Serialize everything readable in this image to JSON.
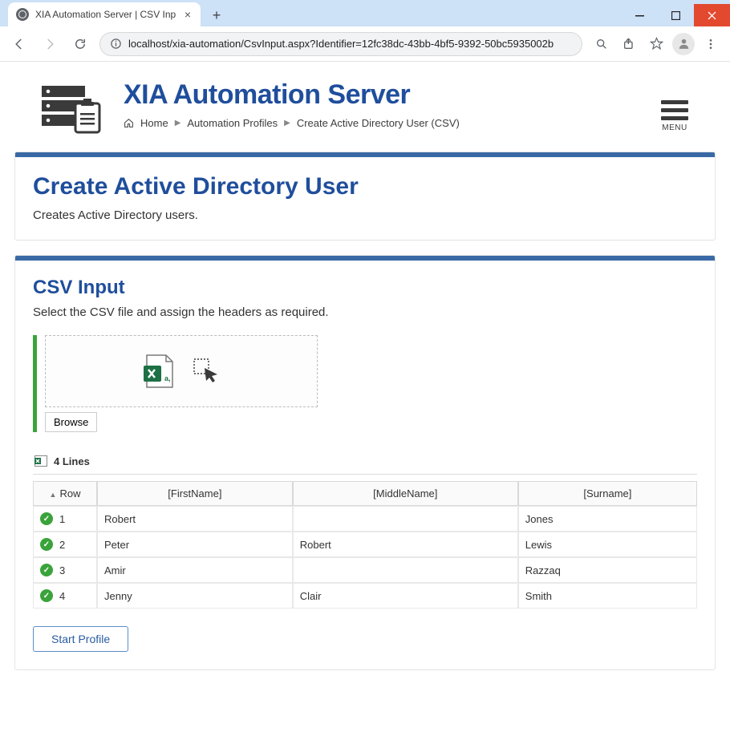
{
  "window": {
    "tab_title": "XIA Automation Server | CSV Inp",
    "url_host": "localhost",
    "url_path": "/xia-automation/CsvInput.aspx?Identifier=12fc38dc-43bb-4bf5-9392-50bc5935002b"
  },
  "header": {
    "app_title": "XIA Automation Server",
    "menu_label": "MENU",
    "breadcrumb": {
      "home": "Home",
      "profiles": "Automation Profiles",
      "current": "Create Active Directory User (CSV)"
    }
  },
  "title_card": {
    "title": "Create Active Directory User",
    "subtitle": "Creates Active Directory users."
  },
  "csv_card": {
    "title": "CSV Input",
    "subtitle": "Select the CSV file and assign the headers as required.",
    "browse_label": "Browse",
    "lines_summary": "4 Lines",
    "columns": {
      "row": "Row",
      "first": "[FirstName]",
      "middle": "[MiddleName]",
      "last": "[Surname]"
    },
    "rows": [
      {
        "n": "1",
        "first": "Robert",
        "middle": "",
        "last": "Jones"
      },
      {
        "n": "2",
        "first": "Peter",
        "middle": "Robert",
        "last": "Lewis"
      },
      {
        "n": "3",
        "first": "Amir",
        "middle": "",
        "last": "Razzaq"
      },
      {
        "n": "4",
        "first": "Jenny",
        "middle": "Clair",
        "last": "Smith"
      }
    ],
    "start_label": "Start Profile"
  }
}
